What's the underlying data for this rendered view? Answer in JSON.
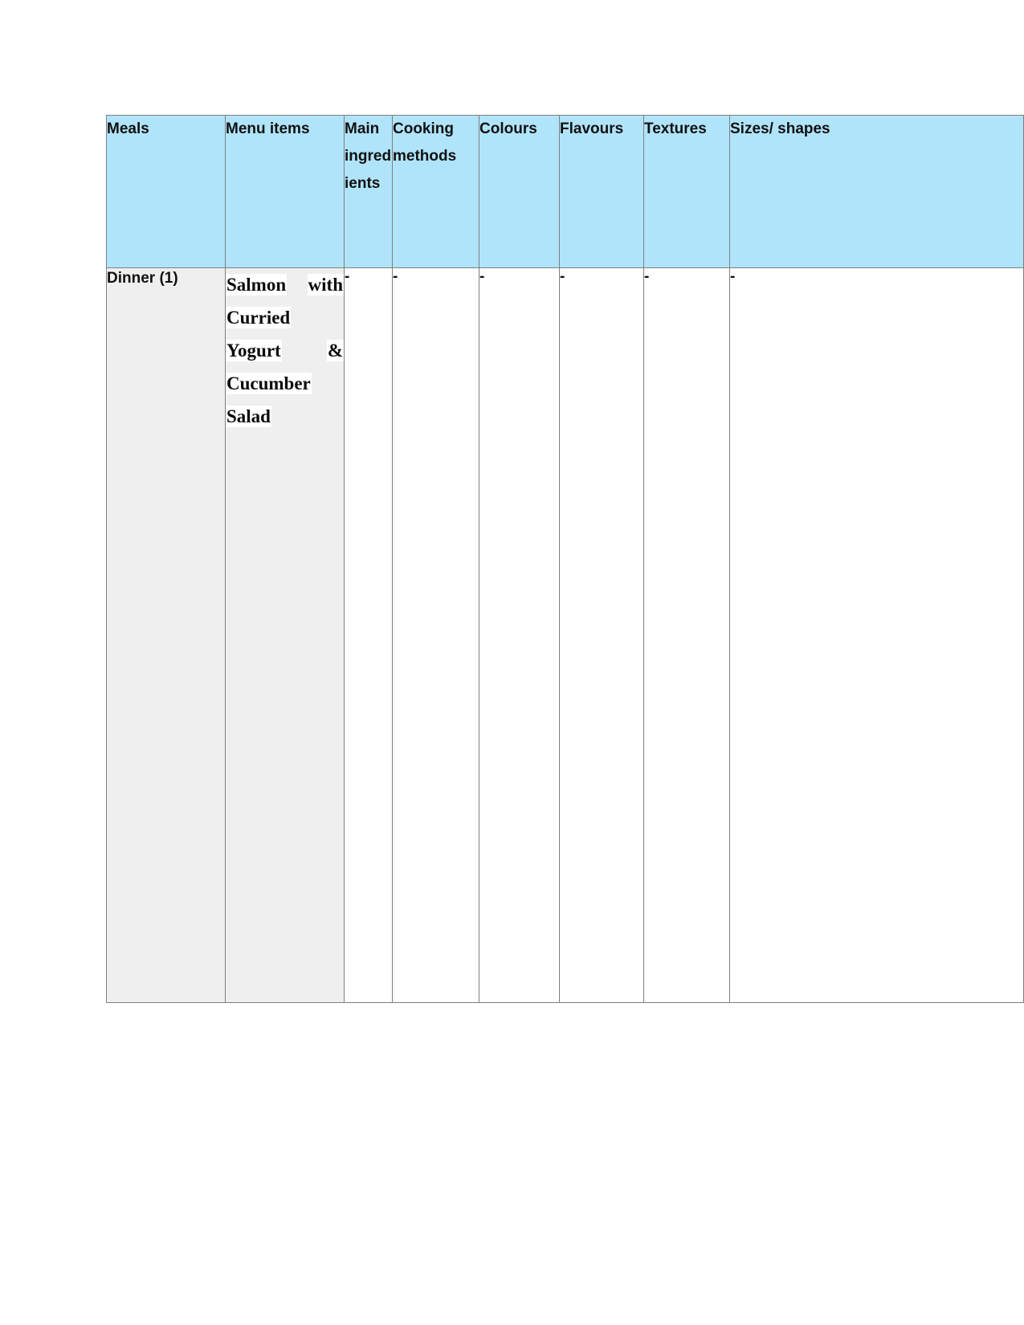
{
  "table": {
    "headers": [
      {
        "label": "Meals"
      },
      {
        "label": "Menu items"
      },
      {
        "label": "Main ingredients"
      },
      {
        "label": "Cooking methods"
      },
      {
        "label": "Colours"
      },
      {
        "label": "Flavours"
      },
      {
        "label": "Textures"
      },
      {
        "label": "Sizes/ shapes"
      }
    ],
    "rows": [
      {
        "meals": "Dinner (1)",
        "menu_items": "Salmon with Curried Yogurt & Cucumber Salad",
        "menu_items_words": [
          "Salmon",
          "with",
          "Curried",
          "Yogurt",
          "&",
          "Cucumber",
          "Salad"
        ],
        "main_ingredients": "-",
        "cooking_methods": "-",
        "colours": "-",
        "flavours": "-",
        "textures": "-",
        "sizes_shapes": "-"
      }
    ]
  },
  "colors": {
    "header_background": "#B0E4FA",
    "body_highlight_background": "#EFEFEF",
    "border": "#7F7F7F",
    "text": "#111111",
    "page_background": "#FFFFFF"
  }
}
